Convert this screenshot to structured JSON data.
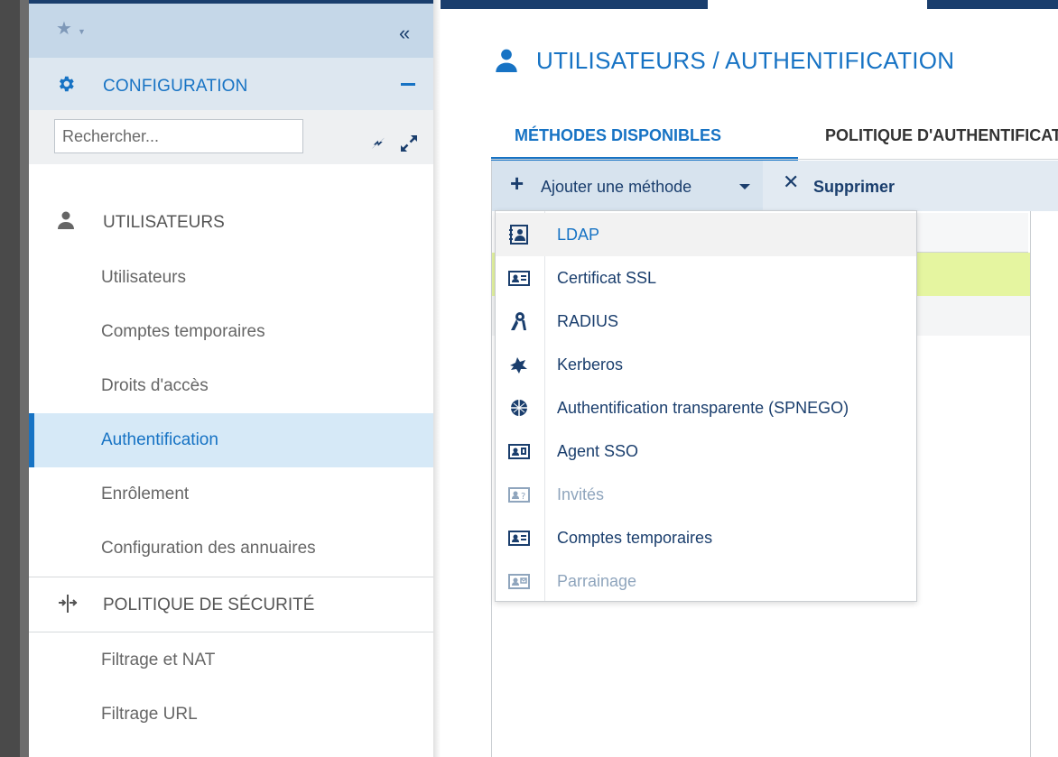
{
  "sidebar": {
    "favorites_icon": "star-icon",
    "collapse_icon": "double-chevron-left-icon",
    "collapse_glyph": "«",
    "section": {
      "label": "CONFIGURATION",
      "icon": "gear-icon"
    },
    "search": {
      "placeholder": "Rechercher..."
    },
    "groups": [
      {
        "label": "UTILISATEURS",
        "icon": "user-icon",
        "items": [
          {
            "label": "Utilisateurs"
          },
          {
            "label": "Comptes temporaires"
          },
          {
            "label": "Droits d'accès"
          },
          {
            "label": "Authentification",
            "active": true
          },
          {
            "label": "Enrôlement"
          },
          {
            "label": "Configuration des annuaires"
          }
        ]
      },
      {
        "label": "POLITIQUE DE SÉCURITÉ",
        "icon": "security-policy-icon",
        "items": [
          {
            "label": "Filtrage et NAT"
          },
          {
            "label": "Filtrage URL"
          }
        ]
      }
    ]
  },
  "main": {
    "title": "UTILISATEURS / AUTHENTIFICATION",
    "title_icon": "user-icon",
    "tabs": [
      {
        "label": "MÉTHODES DISPONIBLES",
        "active": true
      },
      {
        "label": "POLITIQUE D'AUTHENTIFICATION",
        "active": false
      }
    ],
    "toolbar": {
      "add_label": "Ajouter une méthode",
      "add_glyph": "+",
      "delete_label": "Supprimer",
      "delete_glyph": "✕"
    },
    "dropdown": [
      {
        "label": "LDAP",
        "icon": "ldap-directory-icon"
      },
      {
        "label": "Certificat SSL",
        "icon": "ssl-certificate-icon"
      },
      {
        "label": "RADIUS",
        "icon": "radius-icon"
      },
      {
        "label": "Kerberos",
        "icon": "kerberos-icon"
      },
      {
        "label": "Authentification transparente (SPNEGO)",
        "icon": "spnego-icon"
      },
      {
        "label": "Agent SSO",
        "icon": "sso-agent-icon"
      },
      {
        "label": "Invités",
        "icon": "guest-icon",
        "disabled": true
      },
      {
        "label": "Comptes temporaires",
        "icon": "temporary-accounts-icon"
      },
      {
        "label": "Parrainage",
        "icon": "sponsorship-icon",
        "disabled": true
      }
    ]
  },
  "colors": {
    "accent": "#1773c4",
    "navy": "#1a3e6d",
    "selected_row": "#e5f5a0",
    "active_nav": "#d6e9f7"
  }
}
